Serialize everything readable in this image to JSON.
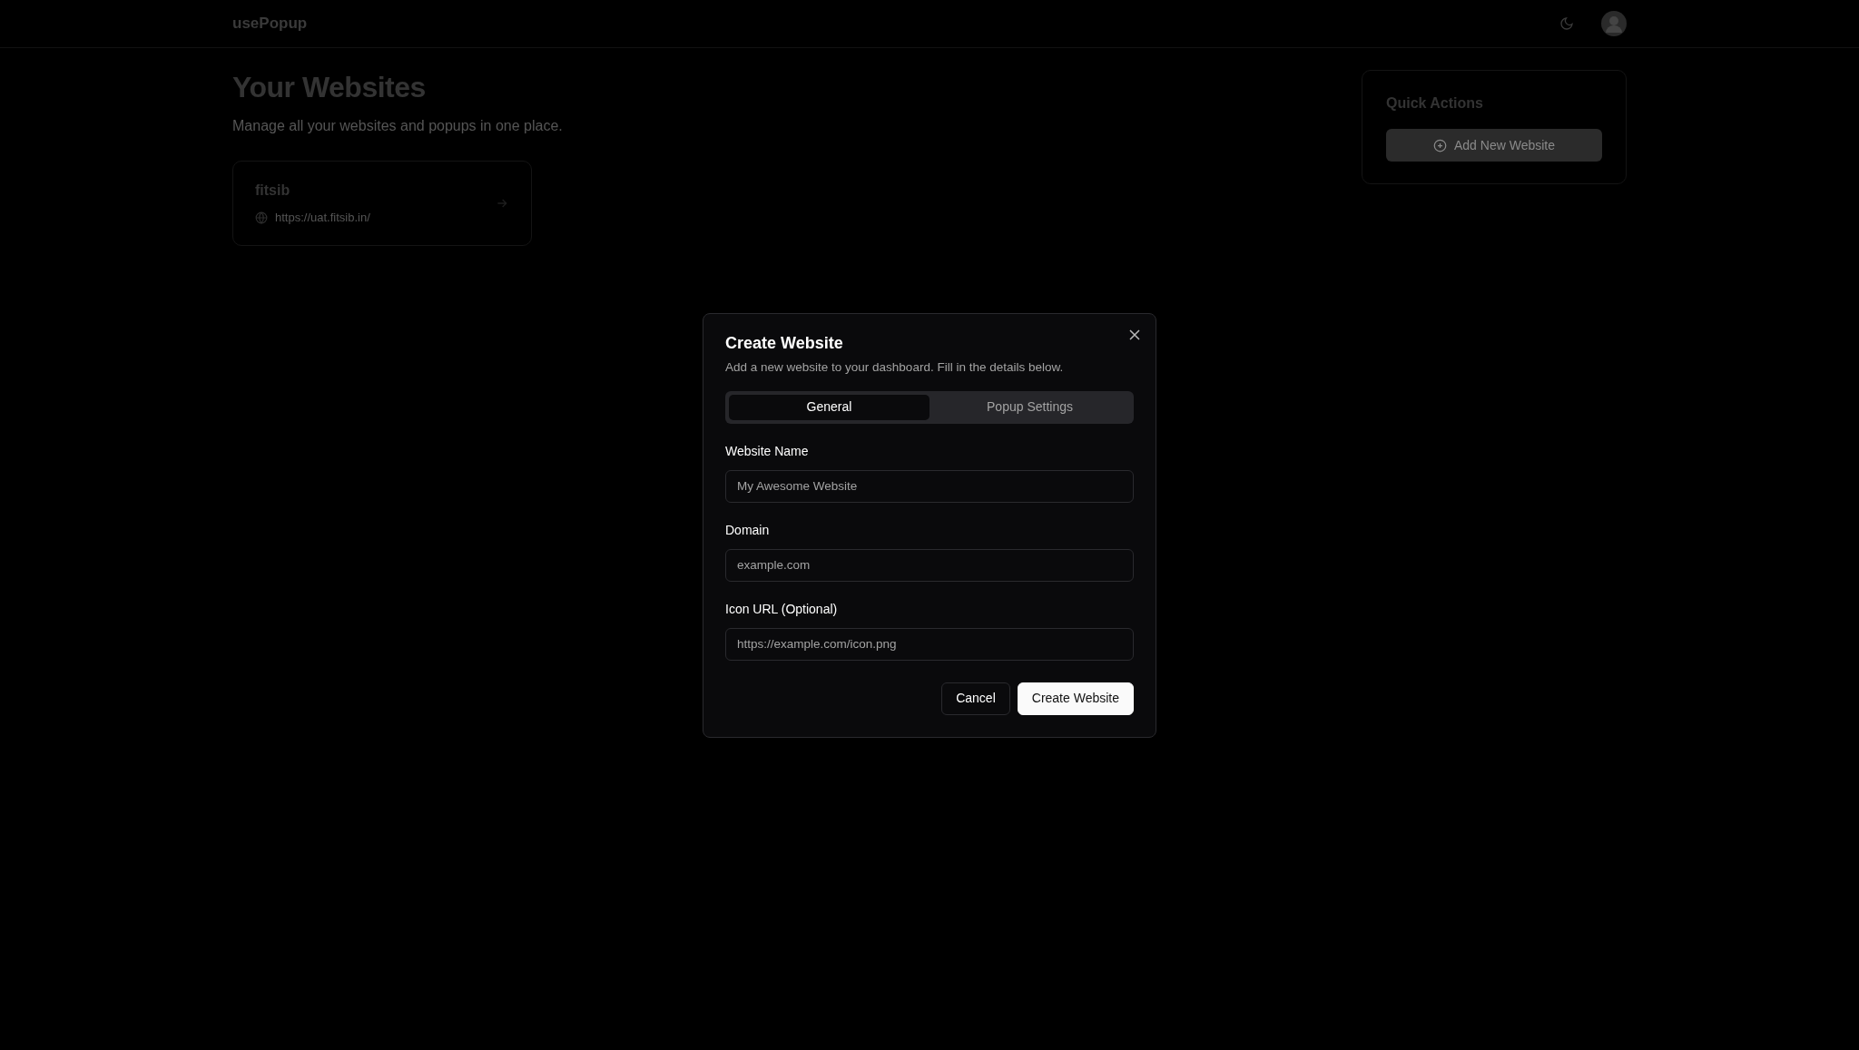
{
  "header": {
    "brand": "usePopup"
  },
  "page": {
    "title": "Your Websites",
    "subtitle": "Manage all your websites and popups in one place."
  },
  "websites": [
    {
      "name": "fitsib",
      "url": "https://uat.fitsib.in/"
    }
  ],
  "quick_actions": {
    "title": "Quick Actions",
    "button": "Add New Website"
  },
  "modal": {
    "title": "Create Website",
    "description": "Add a new website to your dashboard. Fill in the details below.",
    "tabs": [
      {
        "label": "General",
        "selected": true
      },
      {
        "label": "Popup Settings",
        "selected": false
      }
    ],
    "fields": [
      {
        "label": "Website Name",
        "placeholder": "My Awesome Website"
      },
      {
        "label": "Domain",
        "placeholder": "example.com"
      },
      {
        "label": "Icon URL (Optional)",
        "placeholder": "https://example.com/icon.png"
      }
    ],
    "buttons": [
      {
        "label": "Cancel",
        "kind": "secondary"
      },
      {
        "label": "Create Website",
        "kind": "primary"
      }
    ]
  }
}
